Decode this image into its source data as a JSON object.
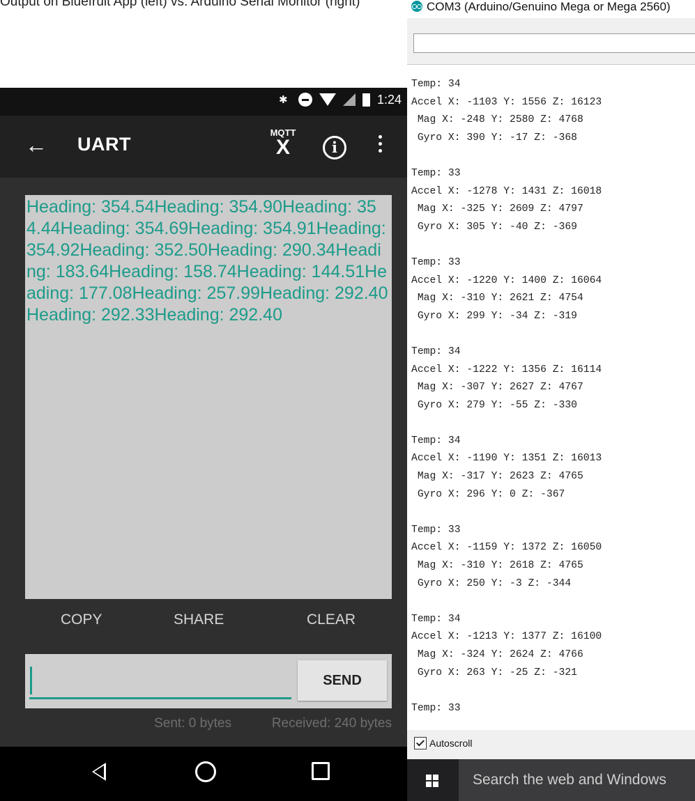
{
  "caption": "Output on Bluefruit App (left) vs. Arduino Serial Monitor (right)",
  "phone": {
    "status": {
      "time": "1:24"
    },
    "toolbar": {
      "title": "UART",
      "mqtt_top": "MQTT",
      "mqtt_bottom": "X",
      "info": "i"
    },
    "output_text": "Heading: 354.54Heading: 354.90Heading: 354.44Heading: 354.69Heading: 354.91Heading: 354.92Heading: 352.50Heading: 290.34Heading: 183.64Heading: 158.74Heading: 144.51Heading: 177.08Heading: 257.99Heading: 292.40Heading: 292.33Heading: 292.40",
    "actions": {
      "copy": "COPY",
      "share": "SHARE",
      "clear": "CLEAR"
    },
    "input": {
      "value": "",
      "send_label": "SEND"
    },
    "counters": {
      "sent": "Sent: 0 bytes",
      "received": "Received: 240 bytes"
    }
  },
  "serial_monitor": {
    "title": "COM3 (Arduino/Genuino Mega or Mega 2560)",
    "input_value": "",
    "log": "Temp: 34\nAccel X: -1103 Y: 1556 Z: 16123\n Mag X: -248 Y: 2580 Z: 4768\n Gyro X: 390 Y: -17 Z: -368\n\nTemp: 33\nAccel X: -1278 Y: 1431 Z: 16018\n Mag X: -325 Y: 2609 Z: 4797\n Gyro X: 305 Y: -40 Z: -369\n\nTemp: 33\nAccel X: -1220 Y: 1400 Z: 16064\n Mag X: -310 Y: 2621 Z: 4754\n Gyro X: 299 Y: -34 Z: -319\n\nTemp: 34\nAccel X: -1222 Y: 1356 Z: 16114\n Mag X: -307 Y: 2627 Z: 4767\n Gyro X: 279 Y: -55 Z: -330\n\nTemp: 34\nAccel X: -1190 Y: 1351 Z: 16013\n Mag X: -317 Y: 2623 Z: 4765\n Gyro X: 296 Y: 0 Z: -367\n\nTemp: 33\nAccel X: -1159 Y: 1372 Z: 16050\n Mag X: -310 Y: 2618 Z: 4765\n Gyro X: 250 Y: -3 Z: -344\n\nTemp: 34\nAccel X: -1213 Y: 1377 Z: 16100\n Mag X: -324 Y: 2624 Z: 4766\n Gyro X: 263 Y: -25 Z: -321\n\nTemp: 33",
    "autoscroll": {
      "label": "Autoscroll",
      "checked": true
    }
  },
  "taskbar": {
    "search_placeholder": "Search the web and Windows"
  },
  "colors": {
    "accent_teal": "#1d9b8a",
    "output_bg": "#cccccc",
    "arduino_teal": "#00979c"
  }
}
